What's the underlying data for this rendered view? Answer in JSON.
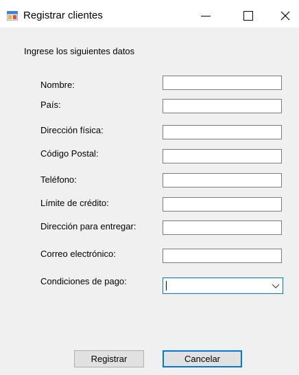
{
  "window": {
    "title": "Registrar clientes",
    "controls": {
      "minimize": "—",
      "maximize": "☐",
      "close": "✕"
    }
  },
  "form": {
    "intro": "Ingrese los siguientes datos",
    "fields": [
      {
        "label": "Nombre:",
        "value": ""
      },
      {
        "label": "País:",
        "value": ""
      },
      {
        "label": "Dirección física:",
        "value": ""
      },
      {
        "label": "Código Postal:",
        "value": ""
      },
      {
        "label": "Teléfono:",
        "value": ""
      },
      {
        "label": "Límite de crédito:",
        "value": ""
      },
      {
        "label": "Dirección para entregar:",
        "value": ""
      },
      {
        "label": "Correo electrónico:",
        "value": ""
      }
    ],
    "payment": {
      "label": "Condiciones de pago:",
      "value": ""
    }
  },
  "buttons": {
    "register": "Registrar",
    "cancel": "Cancelar"
  },
  "colors": {
    "accent": "#0078d7",
    "window_bg": "#f0f0f0",
    "button_bg": "#e1e1e1"
  }
}
